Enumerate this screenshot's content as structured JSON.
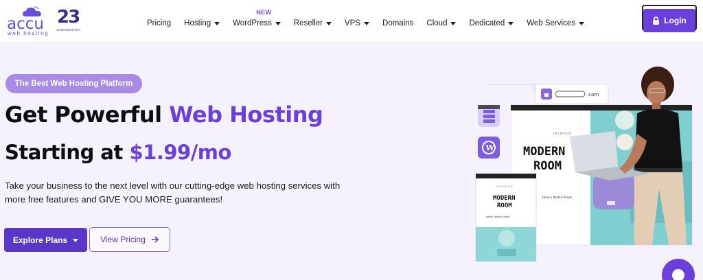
{
  "brand": {
    "name": "accu",
    "sub": "web hosting",
    "anniversary_number": "23",
    "anniversary_label": "ANNIVERSARY"
  },
  "nav": {
    "pricing": "Pricing",
    "hosting": "Hosting",
    "wordpress": "WordPress",
    "wordpress_badge": "NEW",
    "reseller": "Reseller",
    "vps": "VPS",
    "domains": "Domains",
    "cloud": "Cloud",
    "dedicated": "Dedicated",
    "web_services": "Web Services"
  },
  "login_label": "Login",
  "hero": {
    "pill": "The Best Web Hosting Platform",
    "title_part1": "Get Powerful",
    "title_accent": "Web Hosting",
    "subtitle_part1": "Starting at",
    "subtitle_accent": "$1.99/mo",
    "description": "Take your business to the next level with our cutting-edge web hosting services with more free features and GIVE YOU MORE guarantees!",
    "explore_label": "Explore Plans",
    "pricing_label": "View Pricing"
  },
  "illustration": {
    "url_suffix": ".com",
    "site_small_label": "INTERIOR",
    "site_title_line1": "MODERN",
    "site_title_line2": "ROOM",
    "breadcrumb": "Home | Modern Room"
  },
  "colors": {
    "accent": "#6a3fdc",
    "pill": "#a98ae6",
    "background": "#f5f1fd"
  }
}
